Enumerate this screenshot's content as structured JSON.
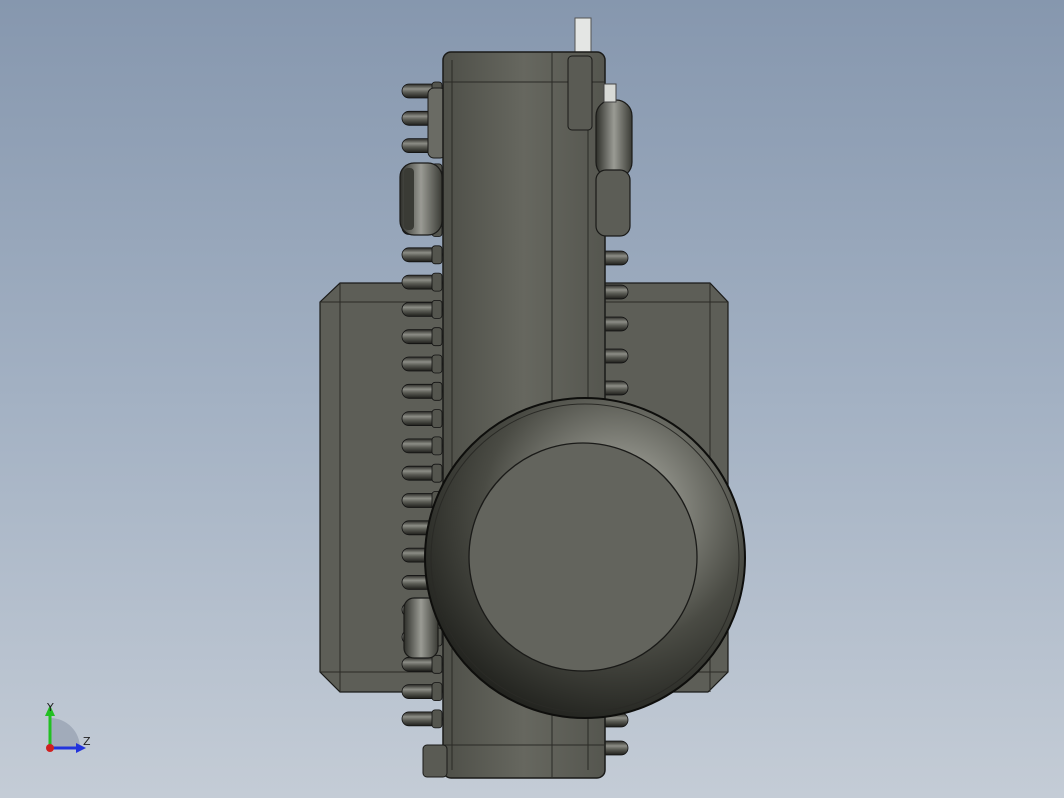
{
  "viewport": {
    "background_top": "#8697ae",
    "background_bottom": "#c4ccd6"
  },
  "model": {
    "body_color": "#5f6058",
    "edge_color": "#1a1a18",
    "bolt_color": "#4a4b45",
    "shaft_color": "#e4e6e4",
    "studs_left_count": 24,
    "studs_right_count": 7
  },
  "triad": {
    "y_label": "Y",
    "z_label": "Z",
    "y_color": "#22c022",
    "z_color": "#2233dd",
    "origin_color": "#d02020"
  }
}
